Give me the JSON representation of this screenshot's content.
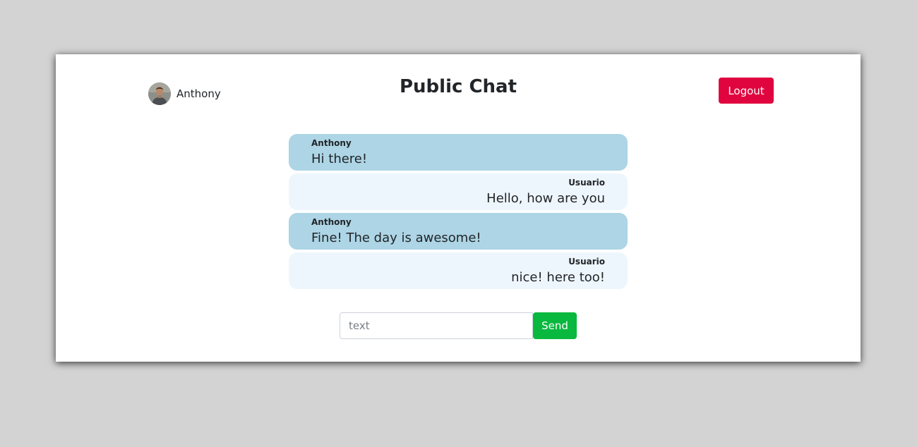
{
  "header": {
    "user_name": "Anthony",
    "title": "Public Chat",
    "logout_label": "Logout"
  },
  "messages": [
    {
      "author": "Anthony",
      "text": "Hi there!",
      "own": true
    },
    {
      "author": "Usuario",
      "text": "Hello, how are you",
      "own": false
    },
    {
      "author": "Anthony",
      "text": "Fine! The day is awesome!",
      "own": true
    },
    {
      "author": "Usuario",
      "text": "nice! here too!",
      "own": false
    }
  ],
  "composer": {
    "value": "",
    "placeholder": "text",
    "send_label": "Send"
  },
  "colors": {
    "own_bubble": "#add5e5",
    "other_bubble": "#eef6fd",
    "logout": "#e0043f",
    "send": "#09b83e"
  },
  "icons": {
    "avatar": "user-avatar-photo"
  }
}
